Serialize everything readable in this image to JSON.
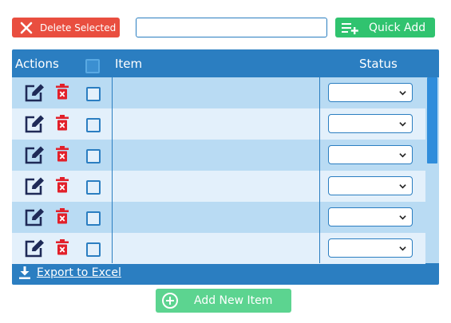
{
  "toolbar": {
    "delete_label": "Delete Selected",
    "search_value": "",
    "quick_add_label": "Quick Add"
  },
  "grid": {
    "headers": {
      "actions": "Actions",
      "item": "Item",
      "status": "Status"
    },
    "rows": [
      {
        "item": "",
        "status": ""
      },
      {
        "item": "",
        "status": ""
      },
      {
        "item": "",
        "status": ""
      },
      {
        "item": "",
        "status": ""
      },
      {
        "item": "",
        "status": ""
      },
      {
        "item": "",
        "status": ""
      }
    ],
    "footer": {
      "export_label": "Export to Excel"
    }
  },
  "add_new_label": "Add New Item",
  "colors": {
    "delete": "#e94e3f",
    "quick_add": "#30c36f",
    "add_new": "#5cd490",
    "grid_header": "#2b7ec1",
    "row_dark": "#b9dbf3",
    "row_light": "#e3f0fb",
    "edit_icon": "#1f2a57",
    "trash_icon": "#e2202a"
  },
  "icons": {
    "delete": "close-icon",
    "quick_add": "playlist-add-icon",
    "edit": "edit-icon",
    "remove": "trash-icon",
    "export": "download-icon",
    "add_new": "plus-circle-icon"
  }
}
